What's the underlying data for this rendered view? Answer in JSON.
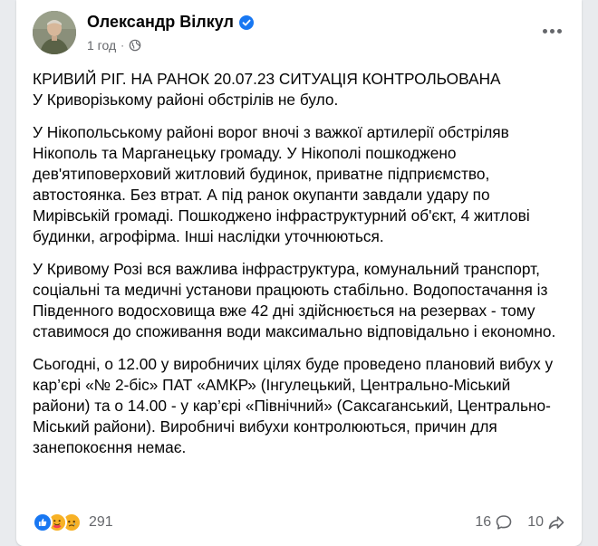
{
  "post": {
    "author": "Олександр Вілкул",
    "time": "1 год",
    "separator": "·",
    "paragraphs": [
      "КРИВИЙ РІГ. НА РАНОК 20.07.23 СИТУАЦІЯ КОНТРОЛЬОВАНА\nУ Криворізькому районі обстрілів не було.",
      "У Нікопольському районі ворог вночі з важкої артилерії обстріляв Нікополь та Марганецьку громаду. У Нікополі пошкоджено дев'ятиповерховий житловий будинок, приватне підприємство, автостоянка. Без втрат. А під ранок окупанти завдали удару по Мирівській громаді. Пошкоджено інфраструктурний об'єкт, 4 житлові будинки, агрофірма. Інші наслідки уточнюються.",
      "У Кривому Розі вся важлива інфраструктура, комунальний транспорт, соціальні та медичні установи працюють стабільно. Водопостачання із Південного водосховища вже 42 дні здійснюється на резервах - тому ставимося до споживання води максимально відповідально і економно.",
      "Сьогодні, о 12.00 у виробничих цілях буде проведено плановий вибух у кар’єрі «№ 2-біс» ПАТ «АМКР» (Інгулецький, Центрально-Міський райони) та о 14.00 - у кар’єрі «Північний» (Саксаганський, Центрально-Міський райони). Виробничі вибухи контролюються, причин для занепокоєння немає."
    ]
  },
  "footer": {
    "reaction_icons": [
      "like-icon",
      "care-icon",
      "sad-icon"
    ],
    "reaction_count": "291",
    "comments_count": "16",
    "shares_count": "10"
  },
  "colors": {
    "accent": "#1877f2",
    "secondary_text": "#65676b",
    "sad": "#f7b125"
  }
}
